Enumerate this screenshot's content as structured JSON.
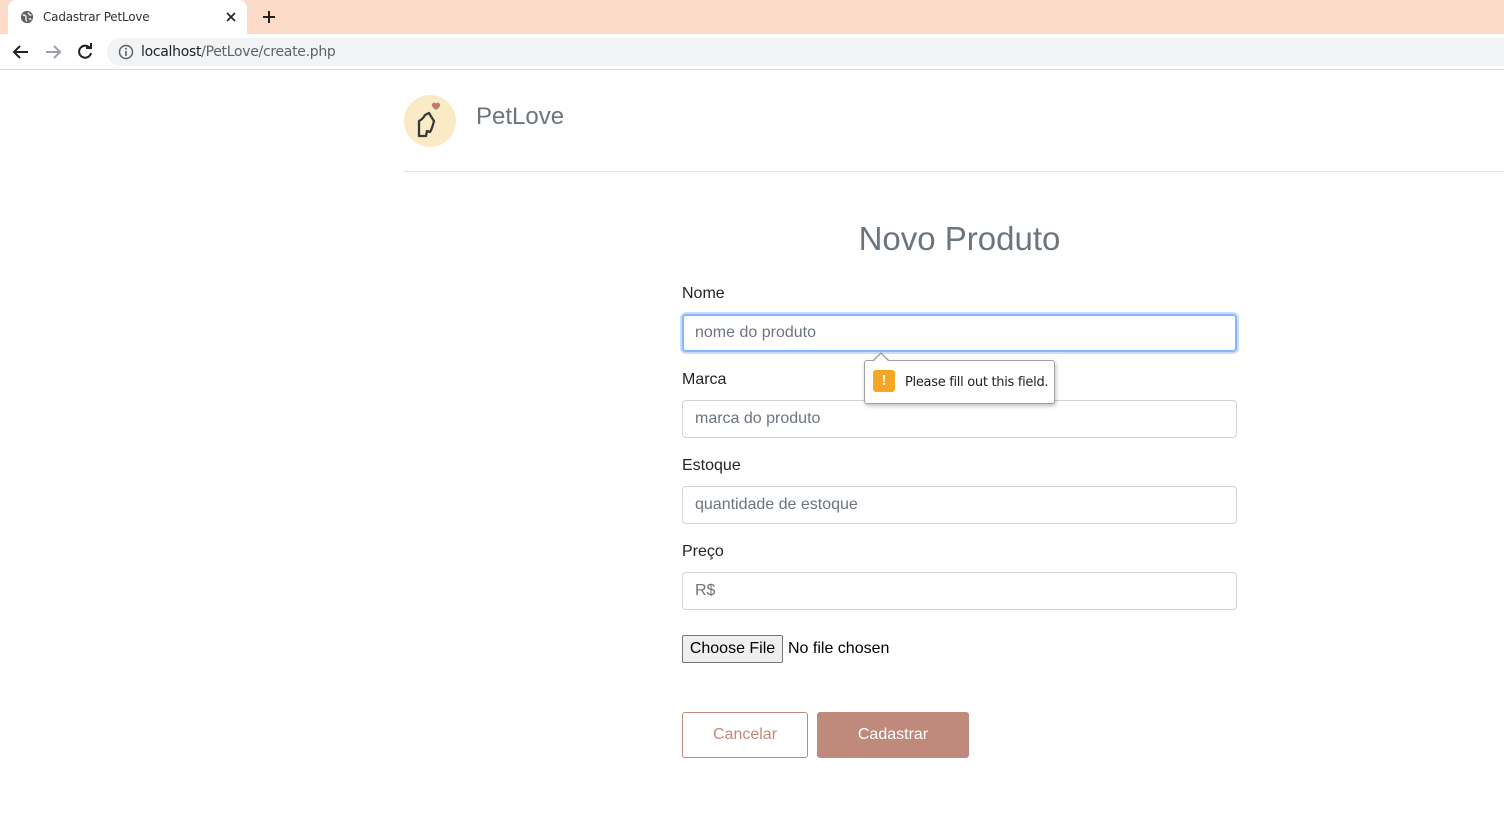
{
  "browser": {
    "tab_title": "Cadastrar PetLove",
    "url_host": "localhost",
    "url_path": "/PetLove/create.php"
  },
  "header": {
    "brand": "PetLove"
  },
  "form": {
    "title": "Novo Produto",
    "fields": [
      {
        "label": "Nome",
        "placeholder": "nome do produto",
        "value": ""
      },
      {
        "label": "Marca",
        "placeholder": "marca do produto",
        "value": ""
      },
      {
        "label": "Estoque",
        "placeholder": "quantidade de estoque",
        "value": ""
      },
      {
        "label": "Preço",
        "placeholder": "R$",
        "value": ""
      }
    ],
    "file_button": "Choose File",
    "file_status": "No file chosen",
    "cancel_label": "Cancelar",
    "submit_label": "Cadastrar"
  },
  "validation": {
    "message": "Please fill out this field."
  },
  "colors": {
    "accent": "#bf8a7b",
    "tabstrip": "#fcdcc9",
    "logo_bg": "#fbeac6",
    "warning": "#f5a623",
    "focus": "#86b7fe"
  },
  "icons": {
    "tab": "globe-icon",
    "close": "close-icon",
    "new_tab": "plus-icon",
    "back": "back-arrow-icon",
    "forward": "forward-arrow-icon",
    "reload": "reload-icon",
    "site_info": "info-icon",
    "logo": "pet-heart-logo-icon",
    "warning": "warning-icon"
  }
}
